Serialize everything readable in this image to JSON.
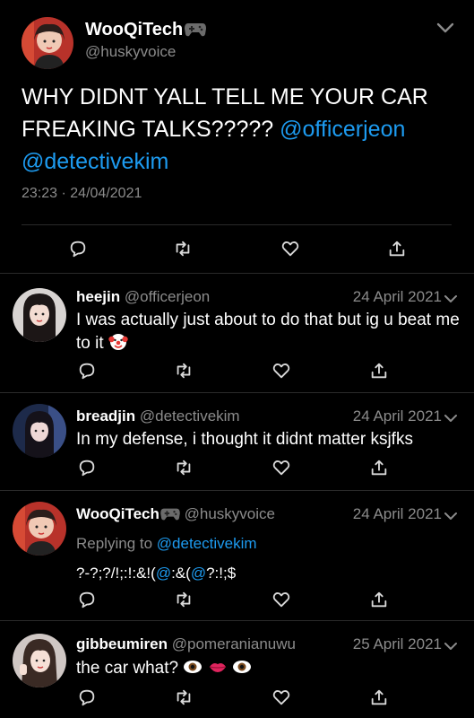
{
  "main_tweet": {
    "display_name": "WooQiTech",
    "handle": "@huskyvoice",
    "text_before": "WHY DIDNT YALL TELL ME YOUR CAR FREAKING TALKS?????",
    "mention_1": "@officerjeon",
    "mention_2": "@detectivekim",
    "time": "23:23",
    "dot": "·",
    "date": "24/04/2021"
  },
  "replies": [
    {
      "display_name": "heejin",
      "handle": "@officerjeon",
      "date": "24 April 2021",
      "text": "I was actually just about to do that but ig u beat me to it",
      "emoji": "clown-face"
    },
    {
      "display_name": "breadjin",
      "handle": "@detectivekim",
      "date": "24 April 2021",
      "text": "In my defense, i thought it didnt matter ksjfks"
    },
    {
      "display_name": "WooQiTech",
      "handle": "@huskyvoice",
      "date": "24 April 2021",
      "replying_to_label": "Replying to",
      "replying_to": "@detectivekim",
      "text_a": "?-?;?/!;:!:&!(",
      "mention_a": "@",
      "text_b": ":&(",
      "mention_b": "@",
      "text_c": "?:!;$"
    },
    {
      "display_name": "gibbeumiren",
      "handle": "@pomeranianuwu",
      "date": "25 April 2021",
      "text": "the car what?",
      "emojis": [
        "eye",
        "lips",
        "eye"
      ]
    }
  ],
  "icons": {
    "reply": "speech-bubble-icon",
    "retweet": "retweet-icon",
    "like": "heart-icon",
    "share": "share-icon",
    "gamepad": "game-controller-icon",
    "menu": "chevron-down-icon"
  },
  "colors": {
    "background": "#000000",
    "mention": "#1d9bf0",
    "secondary_text": "#8b8b8b",
    "separator": "#2a2a2a"
  }
}
